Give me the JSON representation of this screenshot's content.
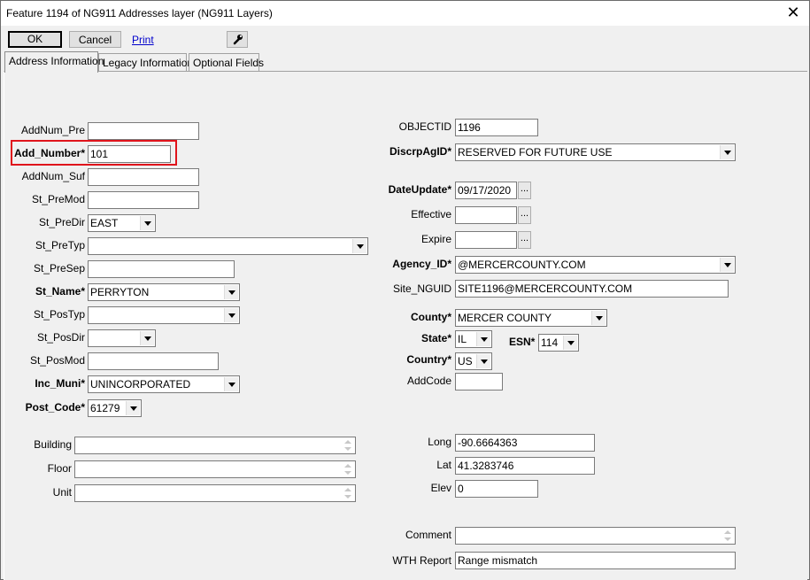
{
  "window": {
    "title": "Feature 1194 of NG911 Addresses layer  (NG911 Layers)",
    "close_glyph": "✕"
  },
  "toolbar": {
    "ok_label": "OK",
    "cancel_label": "Cancel",
    "print_label": "Print",
    "tools_icon": "wrench-icon"
  },
  "tabs": [
    "Address Information",
    "Legacy Information",
    "Optional Fields"
  ],
  "left": {
    "addnum_pre": {
      "label": "AddNum_Pre",
      "value": ""
    },
    "add_number": {
      "label": "Add_Number*",
      "value": "101"
    },
    "addnum_suf": {
      "label": "AddNum_Suf",
      "value": ""
    },
    "st_premod": {
      "label": "St_PreMod",
      "value": ""
    },
    "st_predir": {
      "label": "St_PreDir",
      "value": "EAST"
    },
    "st_pretyp": {
      "label": "St_PreTyp",
      "value": ""
    },
    "st_presep": {
      "label": "St_PreSep",
      "value": ""
    },
    "st_name": {
      "label": "St_Name*",
      "value": "PERRYTON"
    },
    "st_postyp": {
      "label": "St_PosTyp",
      "value": ""
    },
    "st_posdir": {
      "label": "St_PosDir",
      "value": ""
    },
    "st_posmod": {
      "label": "St_PosMod",
      "value": ""
    },
    "inc_muni": {
      "label": "Inc_Muni*",
      "value": "UNINCORPORATED"
    },
    "post_code": {
      "label": "Post_Code*",
      "value": "61279"
    },
    "building": {
      "label": "Building",
      "value": ""
    },
    "floor": {
      "label": "Floor",
      "value": ""
    },
    "unit": {
      "label": "Unit",
      "value": ""
    }
  },
  "right": {
    "objectid": {
      "label": "OBJECTID",
      "value": "1196"
    },
    "discrpagid": {
      "label": "DiscrpAgID*",
      "value": "RESERVED FOR FUTURE USE"
    },
    "dateupdate": {
      "label": "DateUpdate*",
      "value": "09/17/2020"
    },
    "effective": {
      "label": "Effective",
      "value": ""
    },
    "expire": {
      "label": "Expire",
      "value": ""
    },
    "agency_id": {
      "label": "Agency_ID*",
      "value": "@MERCERCOUNTY.COM"
    },
    "site_nguid": {
      "label": "Site_NGUID",
      "value": "SITE1196@MERCERCOUNTY.COM"
    },
    "county": {
      "label": "County*",
      "value": "MERCER COUNTY"
    },
    "state": {
      "label": "State*",
      "value": "IL"
    },
    "esn": {
      "label": "ESN*",
      "value": "114"
    },
    "country": {
      "label": "Country*",
      "value": "US"
    },
    "addcode": {
      "label": "AddCode",
      "value": ""
    },
    "long": {
      "label": "Long",
      "value": "-90.6664363"
    },
    "lat": {
      "label": "Lat",
      "value": "41.3283746"
    },
    "elev": {
      "label": "Elev",
      "value": "0"
    },
    "comment": {
      "label": "Comment",
      "value": ""
    },
    "wth_report": {
      "label": "WTH Report",
      "value": "Range mismatch"
    }
  },
  "ellipsis_label": "...",
  "colors": {
    "highlight": "#e0141c",
    "link": "#0000cc",
    "dialog_bg": "#f0f0f0"
  }
}
